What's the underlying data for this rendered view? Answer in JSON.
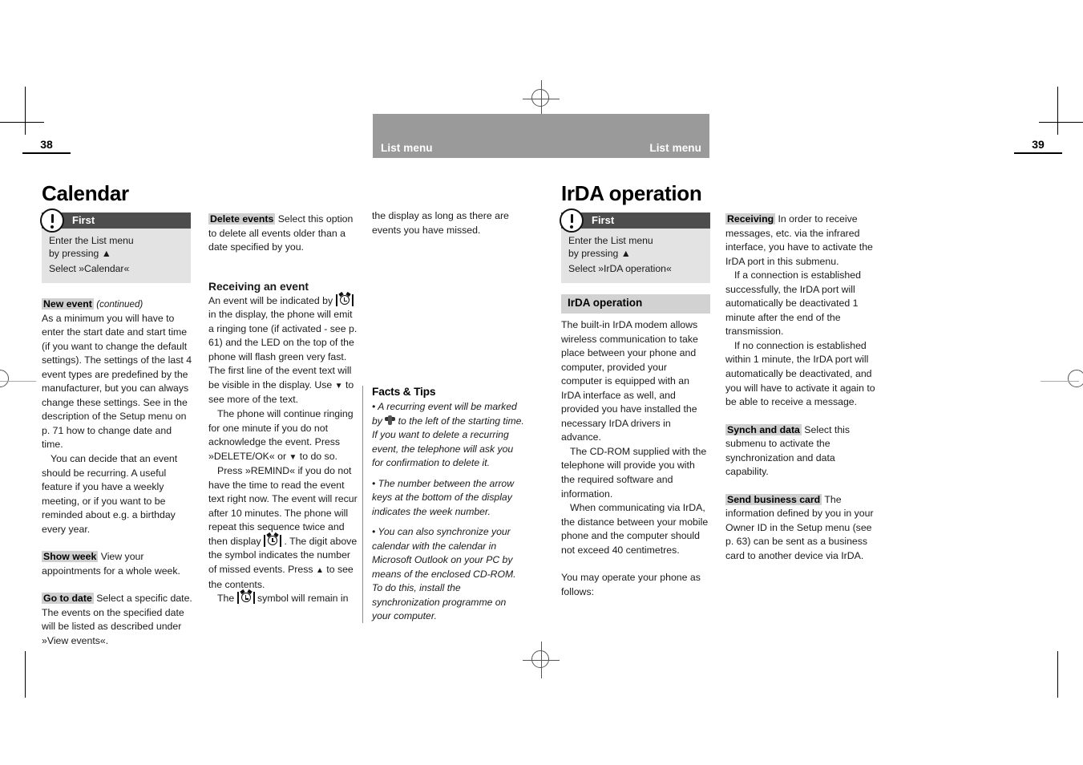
{
  "header": {
    "left_label": "List menu",
    "right_label": "List menu",
    "band_color": "#9a9a9a"
  },
  "folio": {
    "left_page": "38",
    "right_page": "39"
  },
  "left_page": {
    "title": "Calendar",
    "first_box": {
      "badge_label": "First",
      "line1": "Enter the List menu",
      "line2": "by pressing  ▲",
      "line3": "Select »Calendar«"
    },
    "col1": {
      "new_event_kw": "New event",
      "new_event_note": "(continued)",
      "p1": "As a minimum you will have to enter the start date and start time (if you want to change the default settings). The settings of the last 4 event types are predefined by the manufacturer, but you can always change these settings. See in the description of the Setup menu on p. 71 how to change date and time.",
      "p2": "You can decide that an event should be recurring. A useful feature if you have a weekly meeting, or if you want to be reminded about e.g. a birthday every year.",
      "show_week_kw": "Show week",
      "show_week_text": " View your appointments for a whole week.",
      "go_to_date_kw": "Go to date",
      "go_to_date_text": " Select a specific date. The events on the specified date will be listed as described under »View events«."
    },
    "col2": {
      "delete_events_kw": "Delete events",
      "delete_events_text": " Select this option to delete all events older than a date specified by you.",
      "heading": "Receiving an event",
      "p1_a": "An event will be indicated by ",
      "p1_b": " in the display, the phone will emit a ringing tone (if activated - see p. 61) and the LED on the top of the phone will flash green very fast. The first line of the event text will be visible in the display. Use ",
      "p1_c": " to see more of the text.",
      "p2_a": "The phone will continue ringing for one minute if you do not acknowledge the event. Press »DELETE/OK« or ",
      "p2_b": " to do so.",
      "p3_a": "Press »REMIND« if you do not have the time to read the event text right now. The event will recur after 10 minutes. The phone will repeat this sequence twice and then display ",
      "p3_b": " . The digit above the symbol indicates the number of missed events. Press ",
      "p3_c": " to see the contents.",
      "p4_a": "The ",
      "p4_b": " symbol will remain in"
    },
    "col3": {
      "continuation": "the display as long as there are events you have missed.",
      "facts_title": "Facts & Tips",
      "bullet1_a": "• A recurring event will be marked by ",
      "bullet1_b": " to the left of the starting time. If you want to delete a recurring event, the telephone will ask you for confirmation to delete it.",
      "bullet2": "• The number between the arrow keys at the bottom of the display indicates the week number.",
      "bullet3": "• You can also synchronize your calendar with the calendar in Microsoft Outlook on your PC by means of the enclosed CD-ROM. To do this, install the synchronization programme on your computer."
    }
  },
  "right_page": {
    "title": "IrDA operation",
    "first_box": {
      "badge_label": "First",
      "line1": "Enter the List menu",
      "line2": "by pressing  ▲",
      "line3": "Select »IrDA operation«"
    },
    "section_bar": "IrDA operation",
    "col4": {
      "p1": "The built-in IrDA modem allows wireless communication to take place between your phone and computer, provided your computer is equipped with an IrDA interface as well, and provided you have installed the necessary IrDA drivers in advance.",
      "p2": "The CD-ROM supplied with the telephone will provide you with the required software and information.",
      "p3": "When communicating via IrDA, the distance between your mobile phone and the computer should not exceed 40 centimetres.",
      "p4": "You may operate your phone as follows:"
    },
    "col5": {
      "receiving_kw": "Receiving",
      "receiving_text": " In order to receive messages, etc. via the infrared interface, you have to activate the IrDA port in this submenu.",
      "receiving_p2": "If a connection is established successfully, the IrDA port will automatically be deactivated 1 minute after the end of the transmission.",
      "receiving_p3": "If no connection is established within 1 minute, the IrDA port will automatically be deactivated, and you will have to activate it again to be able to receive a message.",
      "synch_kw": "Synch and data",
      "synch_text": " Select this submenu to activate the synchronization and data capability.",
      "business_kw": "Send business card",
      "business_text": " The information defined by you in your Owner ID in the Setup menu (see p. 63) can be sent as a business card to another device via IrDA."
    }
  },
  "icons": {
    "alarm_clock": "alarm-clock-icon",
    "recurring": "recurring-event-icon",
    "up_arrow": "▲",
    "down_arrow": "▼"
  }
}
